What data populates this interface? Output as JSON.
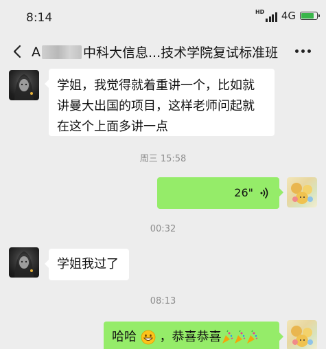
{
  "status_bar": {
    "time": "8:14",
    "hd_label": "HD",
    "network": "4G",
    "battery_level": 0.8
  },
  "chat": {
    "title_prefix": "A",
    "title_suffix": "中科大信息...技术学院复试标准班",
    "more_icon": "more-icon",
    "back_icon": "back-arrow-icon"
  },
  "messages": [
    {
      "side": "left",
      "text": "学姐，我觉得就着重讲一个，比如就讲曼大出国的项目，这样老师问起就在这个上面多讲一点"
    },
    {
      "timestamp": "周三 15:58"
    },
    {
      "side": "right",
      "type": "voice",
      "duration": "26\""
    },
    {
      "timestamp": "00:32"
    },
    {
      "side": "left",
      "text": "学姐我过了"
    },
    {
      "timestamp": "08:13"
    },
    {
      "side": "right",
      "text_before_emoji": "哈哈",
      "text_after_emoji": "，恭喜恭喜",
      "emojis": [
        "grinning-face",
        "party-popper",
        "party-popper",
        "party-popper"
      ]
    }
  ],
  "colors": {
    "background": "#ededed",
    "bubble_self": "#95ec69",
    "bubble_other": "#ffffff",
    "timestamp": "#8c8c8c",
    "battery": "#39b54a"
  }
}
